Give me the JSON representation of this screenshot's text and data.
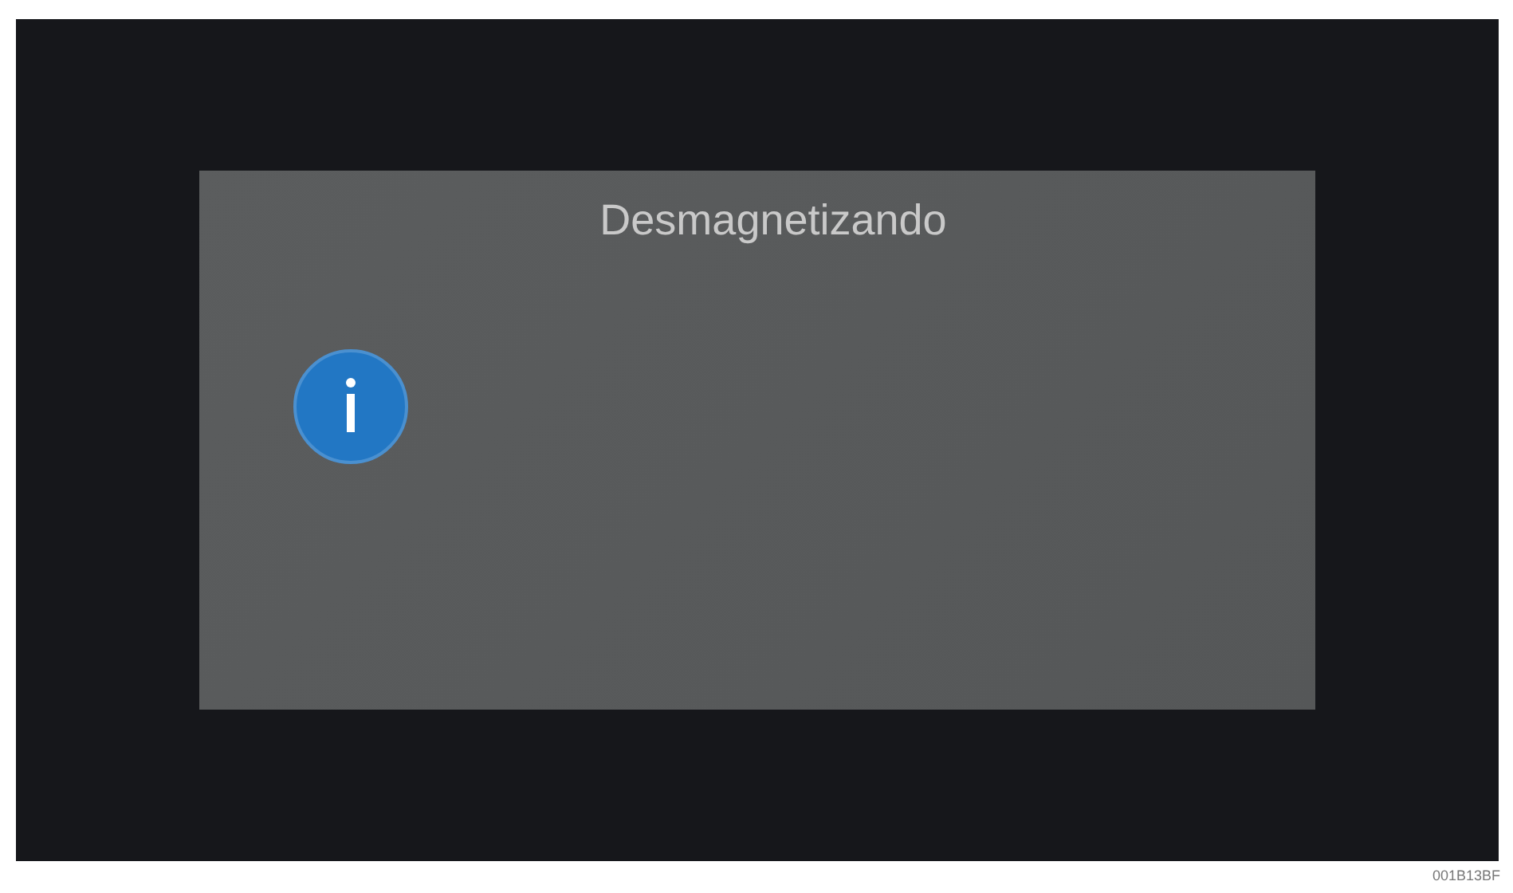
{
  "dialog": {
    "title": "Desmagnetizando",
    "icon": {
      "kind": "info"
    }
  },
  "figure_id": "001B13BF"
}
